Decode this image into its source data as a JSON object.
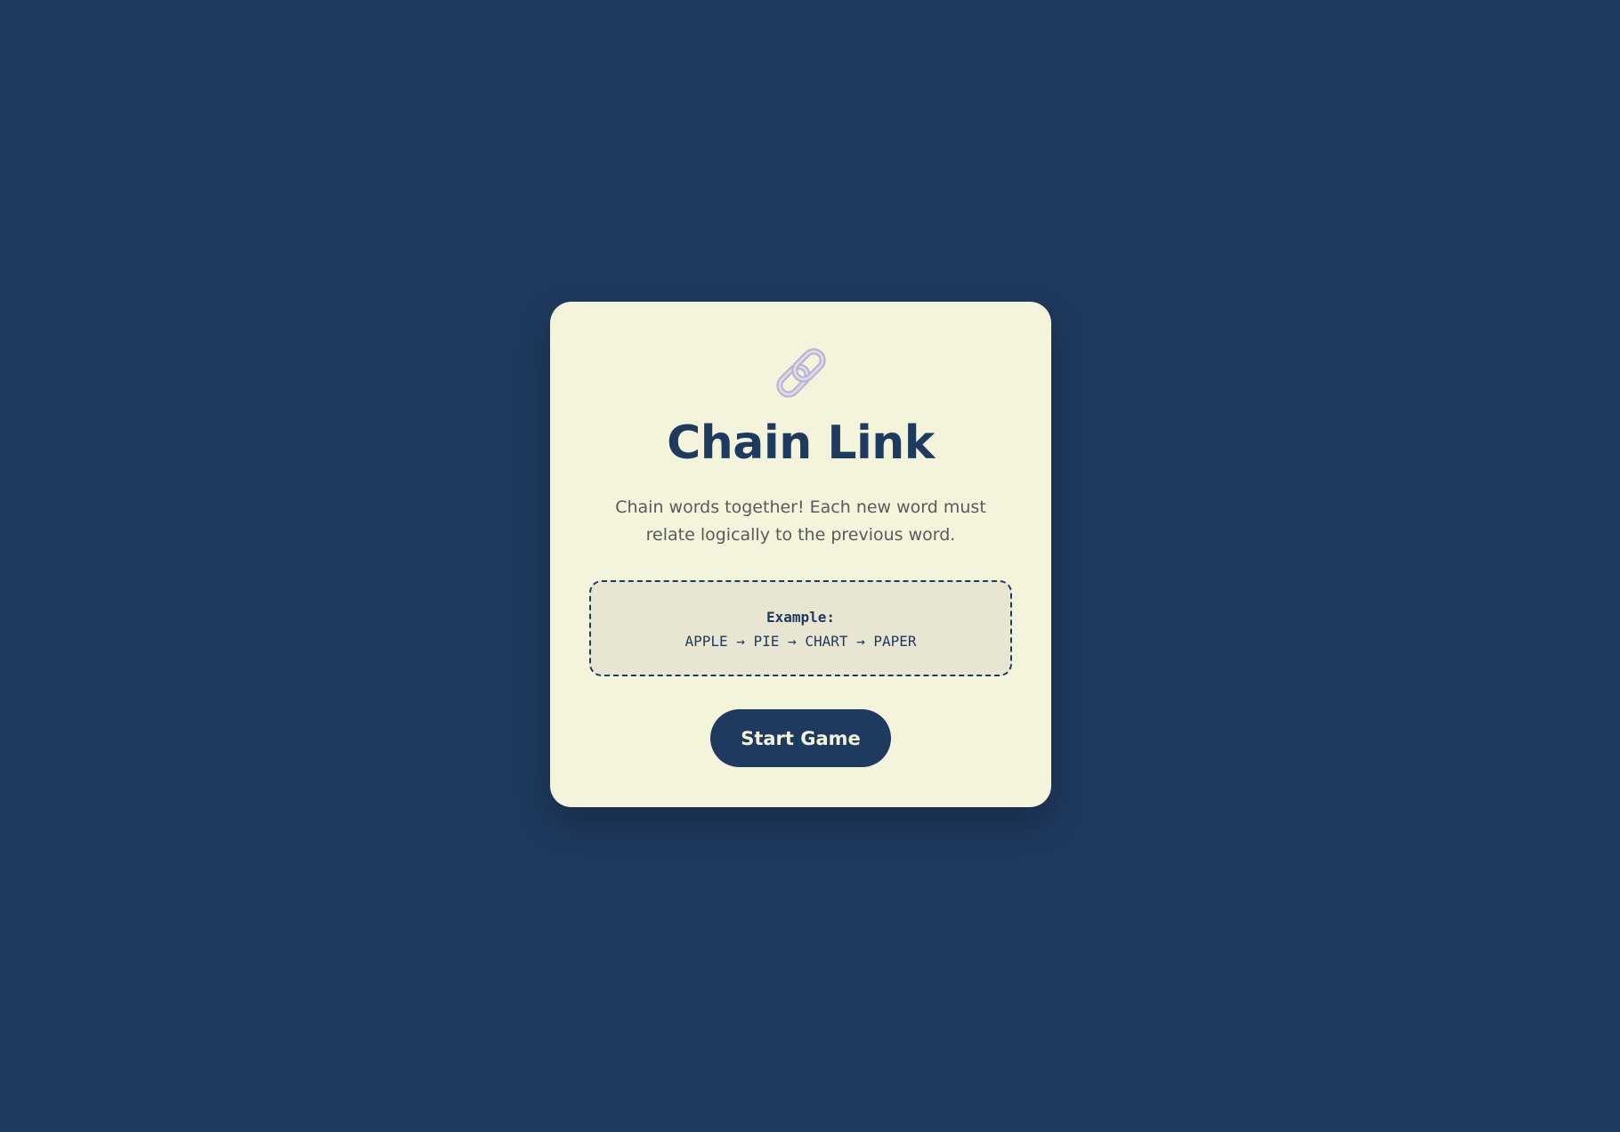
{
  "app": {
    "logo_icon": "chain-link-icon",
    "title": "Chain Link",
    "description": "Chain words together! Each new word must relate logically to the previous word."
  },
  "example": {
    "label": "Example:",
    "chain": "APPLE → PIE → CHART → PAPER"
  },
  "actions": {
    "start_label": "Start Game"
  },
  "colors": {
    "background": "#1f3a5f",
    "card": "#f4f4dc",
    "accent": "#1f3a5f",
    "example_bg": "#e8e6d2",
    "icon": "#c9c3dc"
  }
}
